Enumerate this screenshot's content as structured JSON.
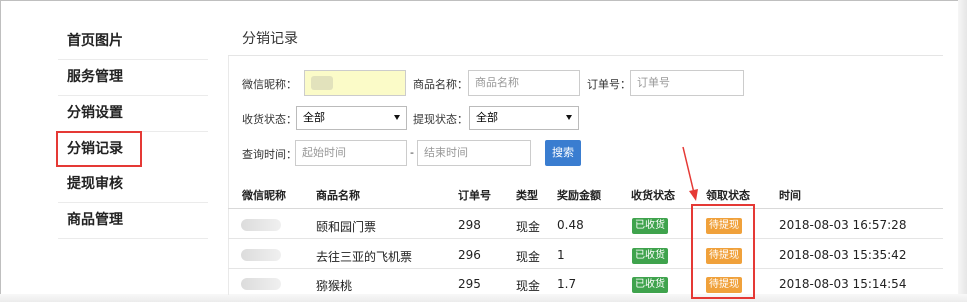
{
  "sidebar": {
    "items": [
      {
        "label": "首页图片",
        "active": false
      },
      {
        "label": "服务管理",
        "active": false
      },
      {
        "label": "分销设置",
        "active": false
      },
      {
        "label": "分销记录",
        "active": true
      },
      {
        "label": "提现审核",
        "active": false
      },
      {
        "label": "商品管理",
        "active": false
      }
    ]
  },
  "page": {
    "title": "分销记录"
  },
  "filters": {
    "nickname_label": "微信昵称：",
    "product_label": "商品名称：",
    "product_placeholder": "商品名称",
    "order_label": "订单号：",
    "order_placeholder": "订单号",
    "receive_status_label": "收货状态：",
    "receive_status_value": "全部",
    "withdraw_status_label": "提现状态：",
    "withdraw_status_value": "全部",
    "time_label": "查询时间：",
    "start_placeholder": "起始时间",
    "time_separator": "-",
    "end_placeholder": "结束时间",
    "search_button": "搜索"
  },
  "table": {
    "headers": [
      "微信昵称",
      "商品名称",
      "订单号",
      "类型",
      "奖励金额",
      "收货状态",
      "领取状态",
      "时间"
    ],
    "rows": [
      {
        "product": "颐和园门票",
        "order": "298",
        "type": "现金",
        "amount": "0.48",
        "receive": "已收货",
        "claim": "待提现",
        "time": "2018-08-03 16:57:28"
      },
      {
        "product": "去往三亚的飞机票",
        "order": "296",
        "type": "现金",
        "amount": "1",
        "receive": "已收货",
        "claim": "待提现",
        "time": "2018-08-03 15:35:42"
      },
      {
        "product": "猕猴桃",
        "order": "295",
        "type": "现金",
        "amount": "1.7",
        "receive": "已收货",
        "claim": "待提现",
        "time": "2018-08-03 15:14:54"
      }
    ]
  },
  "colors": {
    "accent": "#3a7dd0",
    "highlight": "#e53935",
    "status_green": "#3fa34d",
    "status_orange": "#f0a13b"
  }
}
